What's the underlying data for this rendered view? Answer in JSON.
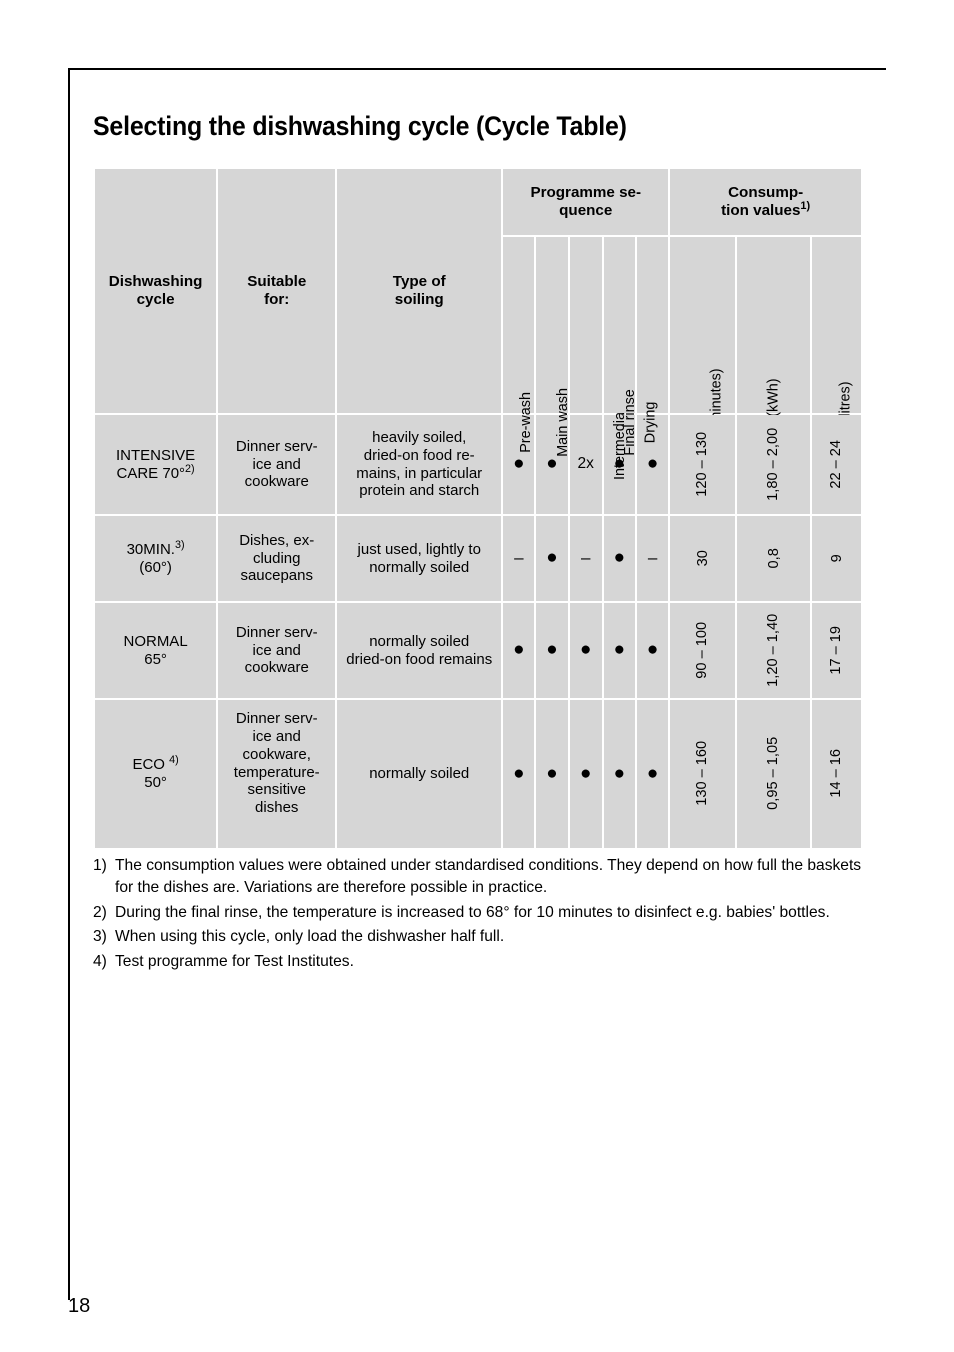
{
  "page": {
    "title": "Selecting the dishwashing cycle (Cycle Table)",
    "number": "18"
  },
  "table": {
    "group_headers": {
      "programme_sequence": "Programme se-\nquence",
      "programme_sequence_line1": "Programme se-",
      "programme_sequence_line2": "quence",
      "consumption_values_line1": "Consump-",
      "consumption_values_line2": "tion values",
      "consumption_values_sup": "1)"
    },
    "column_headers": {
      "cycle_line1": "Dishwashing",
      "cycle_line2": "cycle",
      "suitable_line1": "Suitable",
      "suitable_line2": "for:",
      "soiling_line1": "Type of",
      "soiling_line2": "soiling",
      "pre_wash": "Pre-wash",
      "main_wash": "Main wash",
      "intermediate_rinse": "Intermediate rinse",
      "final_rinse": "Final rinse",
      "drying": "Drying",
      "length": "Length (minutes)",
      "energy": "Energy (kWh)",
      "water": "Water (litres)"
    },
    "rows": [
      {
        "cycle_line1": "INTENSIVE",
        "cycle_line2": "CARE 70°",
        "cycle_sup": "2)",
        "suitable": "Dinner serv-\nice and\ncookware",
        "soiling": "heavily soiled,\ndried-on food re-\nmains, in particular\nprotein and starch",
        "pre_wash": "●",
        "main_wash": "●",
        "intermediate_rinse": "2x",
        "final_rinse": "●",
        "drying": "●",
        "length": "120 – 130",
        "energy": "1,80 – 2,00",
        "water": "22 – 24"
      },
      {
        "cycle_line1": "30MIN.",
        "cycle_sup": "3)",
        "cycle_line2": "(60°)",
        "suitable": "Dishes, ex-\ncluding\nsaucepans",
        "soiling": "just used, lightly to\nnormally soiled",
        "pre_wash": "–",
        "main_wash": "●",
        "intermediate_rinse": "–",
        "final_rinse": "●",
        "drying": "–",
        "length": "30",
        "energy": "0,8",
        "water": "9"
      },
      {
        "cycle_line1": "NORMAL",
        "cycle_line2": "65°",
        "cycle_sup": "",
        "suitable": "Dinner serv-\nice and\ncookware",
        "soiling": "normally soiled\ndried-on food remains",
        "pre_wash": "●",
        "main_wash": "●",
        "intermediate_rinse": "●",
        "final_rinse": "●",
        "drying": "●",
        "length": "90 – 100",
        "energy": "1,20 – 1,40",
        "water": "17 – 19"
      },
      {
        "cycle_line1": "ECO ",
        "cycle_sup": "4)",
        "cycle_line2": "50°",
        "suitable": "Dinner serv-\nice and\ncookware,\ntemperature-\nsensitive\ndishes",
        "soiling": "normally soiled",
        "pre_wash": "●",
        "main_wash": "●",
        "intermediate_rinse": "●",
        "final_rinse": "●",
        "drying": "●",
        "length": "130 – 160",
        "energy": "0,95 – 1,05",
        "water": "14 – 16"
      }
    ]
  },
  "footnotes": [
    {
      "num": "1)",
      "text": "The consumption values were obtained under standardised conditions. They depend on how full the baskets for the dishes are. Variations are therefore possible in practice."
    },
    {
      "num": "2)",
      "text": "During the final rinse, the temperature is increased to 68° for 10 minutes to disinfect e.g. babies' bottles."
    },
    {
      "num": "3)",
      "text": "When using this cycle, only load the dishwasher half full."
    },
    {
      "num": "4)",
      "text": "Test programme for Test Institutes."
    }
  ],
  "colors": {
    "cell_fill": "#d6d6d6",
    "rule": "#000000",
    "text": "#000000"
  }
}
